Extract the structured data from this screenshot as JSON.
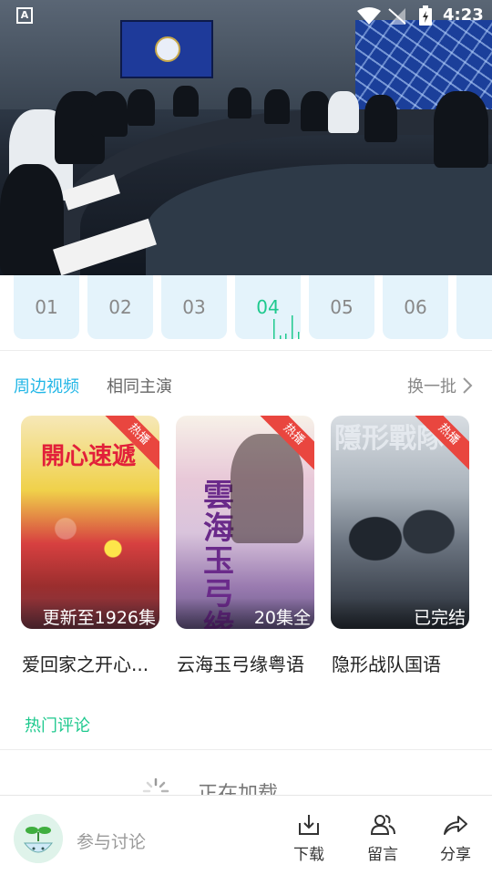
{
  "status_bar": {
    "time": "4:23",
    "left_icon": "A"
  },
  "episodes": [
    {
      "label": "01",
      "active": false
    },
    {
      "label": "02",
      "active": false
    },
    {
      "label": "03",
      "active": false
    },
    {
      "label": "04",
      "active": true
    },
    {
      "label": "05",
      "active": false
    },
    {
      "label": "06",
      "active": false
    }
  ],
  "tabs": {
    "active": "周边视频",
    "other": "相同主演"
  },
  "more_label": "换一批",
  "cards": [
    {
      "badge": "热播",
      "status": "更新至1926集",
      "title": "爱回家之开心..."
    },
    {
      "badge": "热播",
      "status": "20集全",
      "title": "云海玉弓缘粤语"
    },
    {
      "badge": "热播",
      "status": "已完结",
      "title": "隐形战队国语"
    }
  ],
  "hot_comments_label": "热门评论",
  "loading_text": "正在加载",
  "bottom_bar": {
    "discuss_placeholder": "参与讨论",
    "download_label": "下载",
    "comment_label": "留言",
    "share_label": "分享"
  },
  "colors": {
    "accent_blue": "#21b6e6",
    "accent_green": "#1ec98e",
    "badge_red": "#e9463f",
    "episode_bg": "#e4f3fb"
  }
}
